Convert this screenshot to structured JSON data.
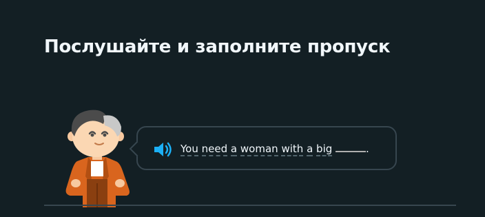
{
  "prompt": {
    "title": "Послушайте и заполните пропуск"
  },
  "exercise": {
    "words": [
      "You",
      "need",
      "a",
      "woman",
      "with",
      "a",
      "big"
    ],
    "trailing_punct": ".",
    "speaker_icon": "speaker-icon",
    "character_icon": "character-avatar"
  },
  "colors": {
    "background": "#131f24",
    "text": "#f1f7fb",
    "border": "#37464f",
    "speaker": "#1cb0f6"
  }
}
